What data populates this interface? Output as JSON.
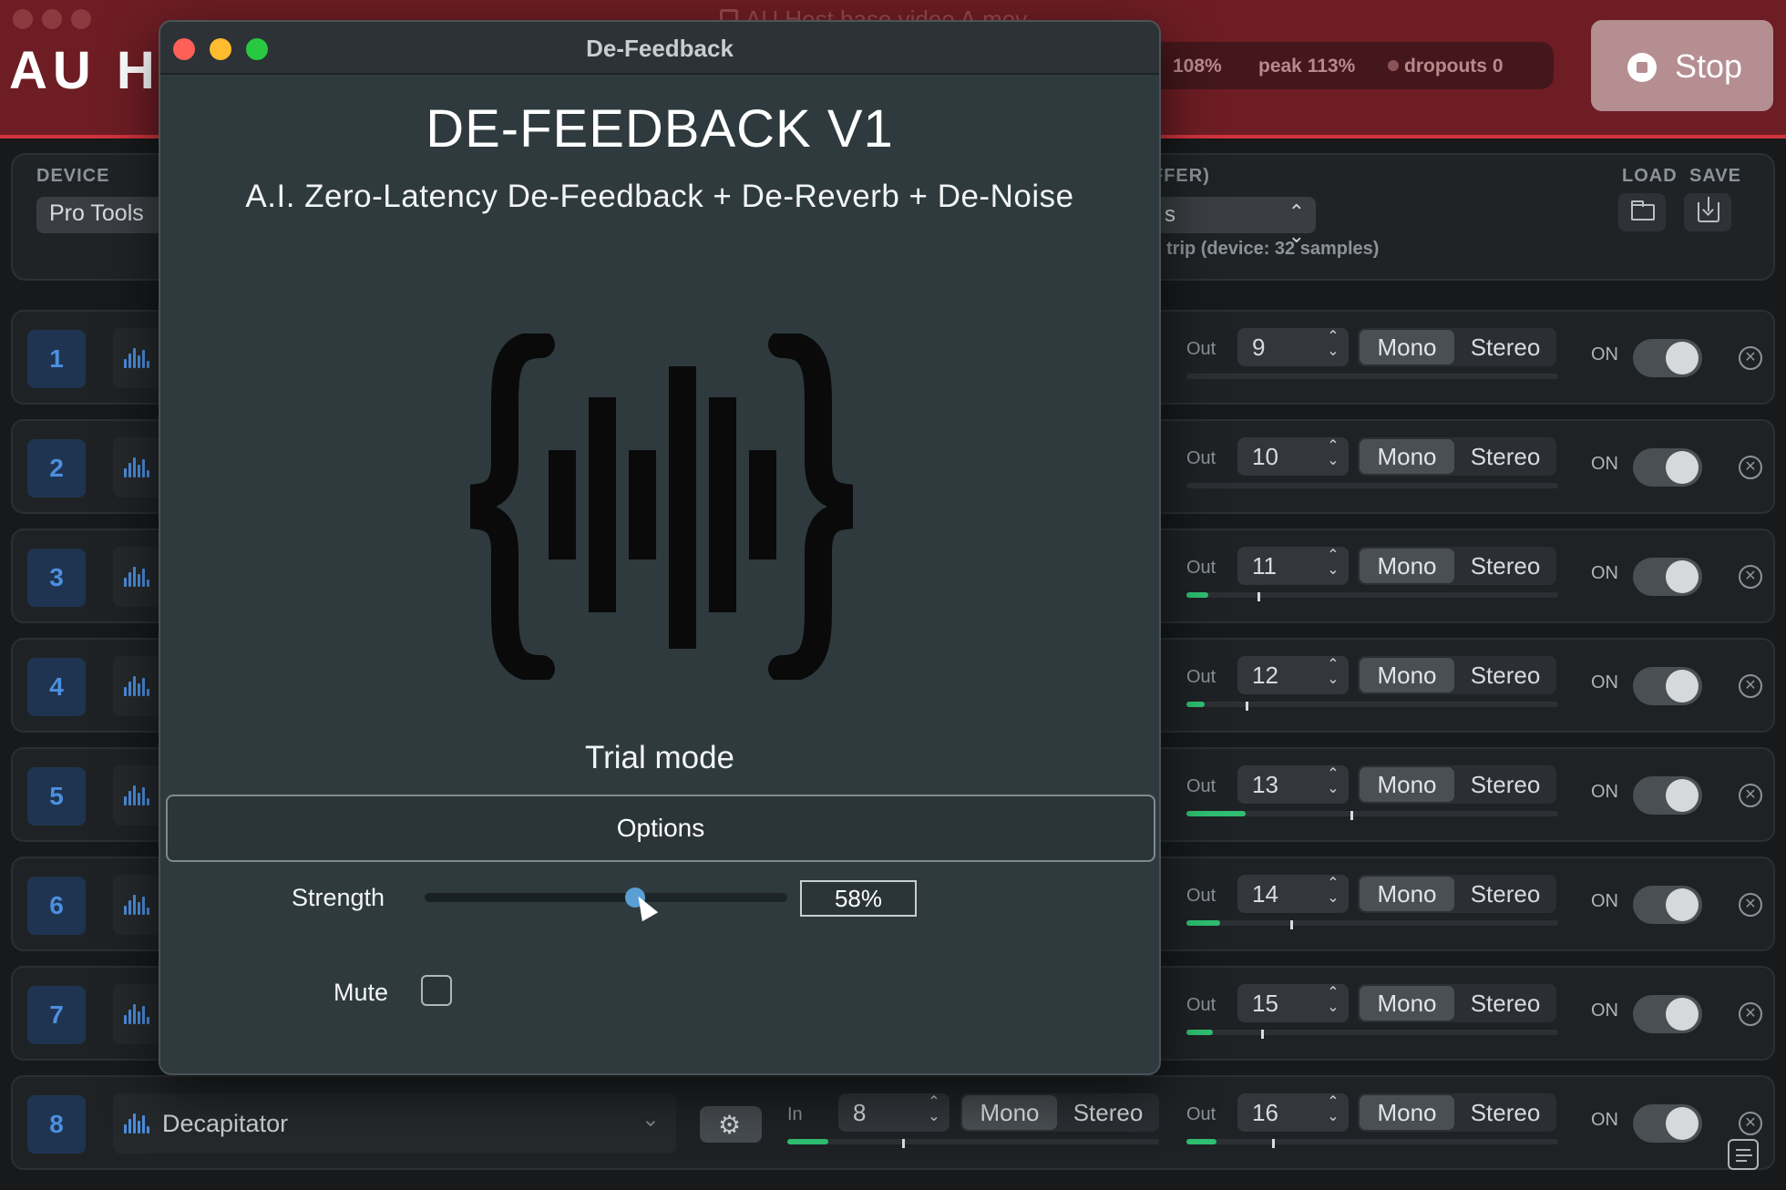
{
  "host": {
    "title": "AU HC",
    "file_title": "AU Host base video A.mov",
    "stats": {
      "cpu": "108%",
      "peak": "peak 113%",
      "dropouts": "dropouts 0"
    },
    "stop_label": "Stop"
  },
  "device": {
    "label": "DEVICE",
    "value": "Pro Tools",
    "buffer_label": "FFER)",
    "buffer_value": "s",
    "roundtrip": "trip (device: 32 samples)",
    "load_label": "LOAD",
    "save_label": "SAVE",
    "load_icon": "folder-icon",
    "save_icon": "download-icon"
  },
  "row_labels": {
    "in": "In",
    "out": "Out",
    "mono": "Mono",
    "stereo": "Stereo",
    "on": "ON"
  },
  "tracks": [
    {
      "num": "1",
      "out": "9",
      "out_level": 0,
      "out_peak": null
    },
    {
      "num": "2",
      "out": "10",
      "out_level": 0,
      "out_peak": null
    },
    {
      "num": "3",
      "out": "11",
      "out_level": 0.06,
      "out_peak": 0.19
    },
    {
      "num": "4",
      "out": "12",
      "out_level": 0.05,
      "out_peak": 0.16
    },
    {
      "num": "5",
      "out": "13",
      "out_level": 0.16,
      "out_peak": 0.44
    },
    {
      "num": "6",
      "out": "14",
      "out_level": 0.09,
      "out_peak": 0.28
    },
    {
      "num": "7",
      "out": "15",
      "out_level": 0.07,
      "out_peak": 0.2
    },
    {
      "num": "8",
      "plugin": "Decapitator",
      "in": "8",
      "out": "16",
      "in_level": 0.11,
      "in_peak": 0.31,
      "out_level": 0.08,
      "out_peak": 0.23
    }
  ],
  "plugin_window": {
    "title": "De-Feedback",
    "heading": "DE-FEEDBACK V1",
    "subtitle": "A.I. Zero-Latency De-Feedback + De-Reverb + De-Noise",
    "trial": "Trial mode",
    "options_label": "Options",
    "strength_label": "Strength",
    "strength_value": "58%",
    "strength_fraction": 0.58,
    "mute_label": "Mute",
    "mute_checked": false
  },
  "colors": {
    "accent_blue": "#4c8fe0",
    "meter_green": "#2fbf71",
    "header_red": "#6e1d24",
    "traffic_red": "#fe5f57",
    "traffic_yellow": "#febc2e",
    "traffic_green": "#28c840"
  }
}
